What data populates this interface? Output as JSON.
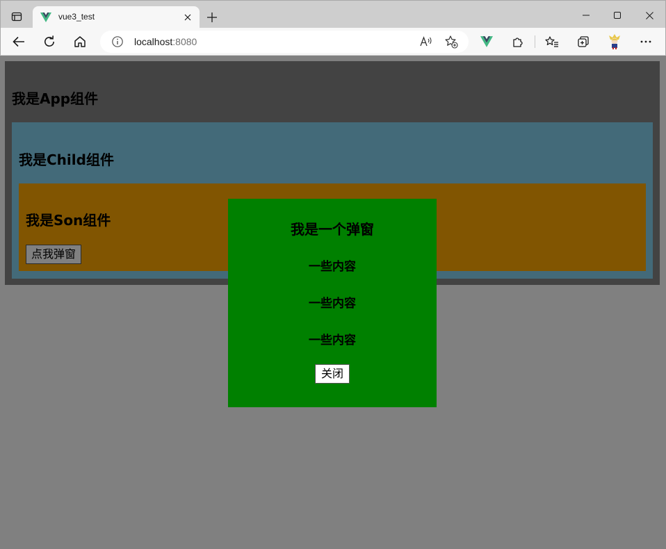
{
  "browser": {
    "tab_title": "vue3_test",
    "url_host": "localhost",
    "url_port": ":8080"
  },
  "app": {
    "title": "我是App组件",
    "child": {
      "title": "我是Child组件",
      "son": {
        "title": "我是Son组件",
        "button_label": "点我弹窗"
      }
    }
  },
  "dialog": {
    "title": "我是一个弹窗",
    "lines": [
      "一些内容",
      "一些内容",
      "一些内容"
    ],
    "close_label": "关闭"
  },
  "colors": {
    "page_bg": "#808080",
    "app_bg": "#434343",
    "child_bg": "#436a79",
    "son_bg": "#815501",
    "dialog_bg": "#008000",
    "vue_green": "#41b883"
  }
}
